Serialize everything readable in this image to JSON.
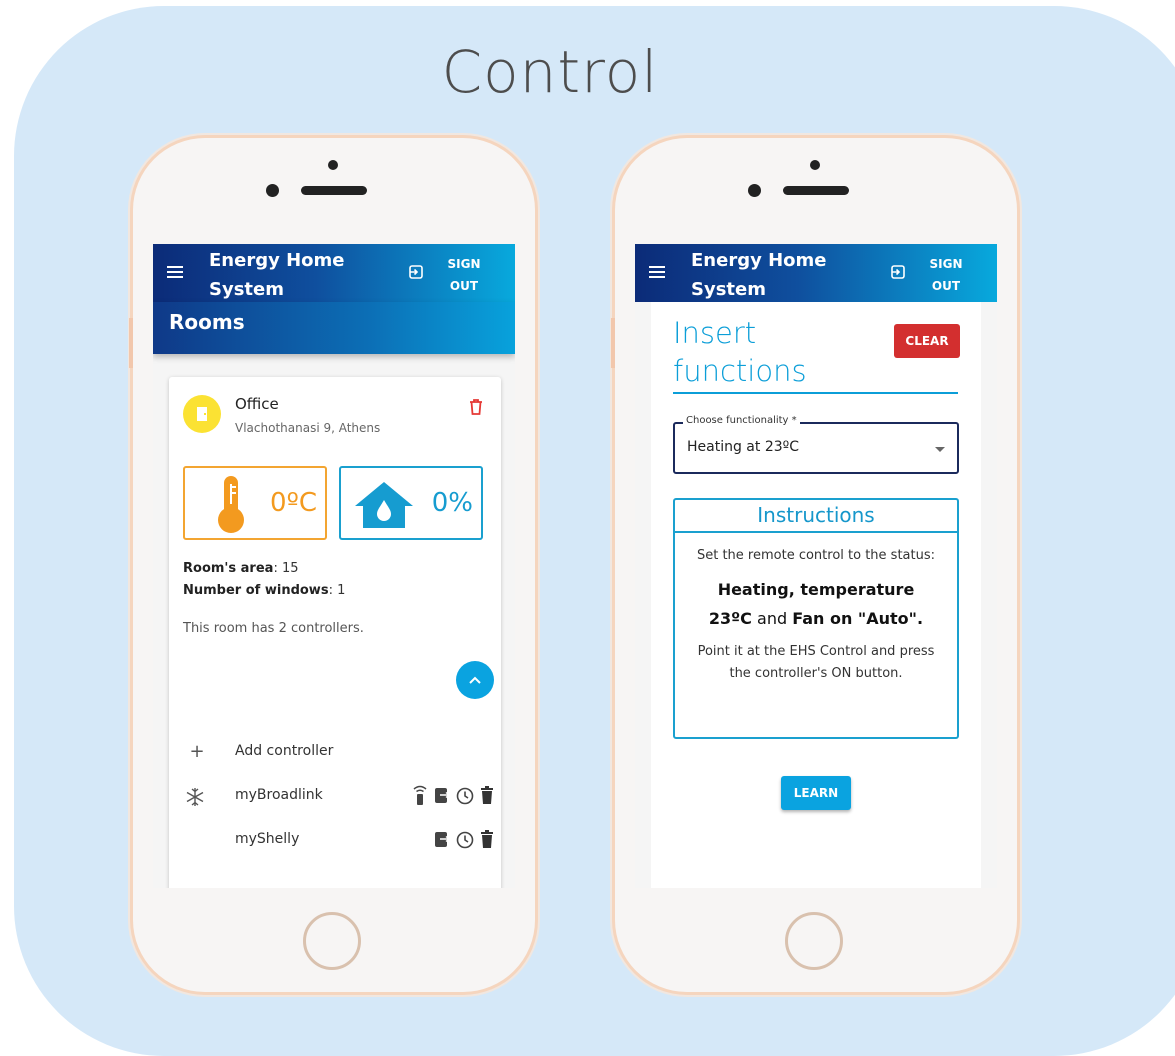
{
  "page_title": "Control",
  "app_title": "Energy Home System",
  "signout_label": "SIGN OUT",
  "left": {
    "section_title": "Rooms",
    "room": {
      "name": "Office",
      "address": "Vlachothanasi 9, Athens",
      "temperature": "0ºC",
      "humidity": "0%",
      "area_label": "Room's area",
      "area_value": ": 15",
      "windows_label": "Number of windows",
      "windows_value": ": 1",
      "description": "This room has 2 controllers."
    },
    "add_controller_label": "Add controller",
    "controllers": [
      {
        "name": "myBroadlink",
        "icon": "snowflake-icon"
      },
      {
        "name": "myShelly",
        "icon": ""
      }
    ]
  },
  "right": {
    "heading": "Insert functions",
    "clear_label": "CLEAR",
    "select_label": "Choose functionality *",
    "select_value": "Heating at 23ºC",
    "instructions_title": "Instructions",
    "instr_line1": "Set the remote control to the status:",
    "instr_strong_a": "Heating, temperature",
    "instr_strong_b": "23ºC",
    "instr_mid": "and",
    "instr_strong_c": "Fan on \"Auto\".",
    "instr_line2": "Point it at the EHS Control and press the controller's ON button.",
    "learn_label": "LEARN"
  },
  "colors": {
    "accent": "#0aa3e0",
    "danger": "#d32f2f",
    "warm": "#f39a1f",
    "panel_bg": "#d5e8f8"
  }
}
